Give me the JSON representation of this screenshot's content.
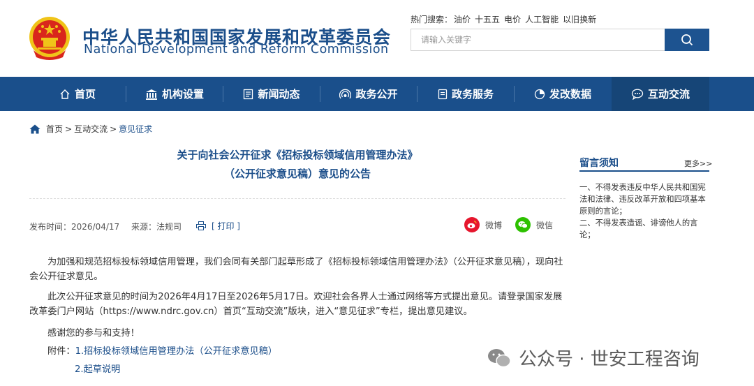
{
  "header": {
    "title_cn": "中华人民共和国国家发展和改革委员会",
    "title_en": "National Development and Reform Commission",
    "emblem_icon": "national-emblem-icon",
    "hot_label": "热门搜索：",
    "hot_words": [
      "油价",
      "十五五",
      "电价",
      "人工智能",
      "以旧换新"
    ],
    "search_placeholder": "请输入关键字",
    "search_icon": "search-icon"
  },
  "nav": {
    "items": [
      {
        "label": "首页",
        "icon": "home-icon"
      },
      {
        "label": "机构设置",
        "icon": "building-icon"
      },
      {
        "label": "新闻动态",
        "icon": "news-icon"
      },
      {
        "label": "政务公开",
        "icon": "broadcast-icon"
      },
      {
        "label": "政务服务",
        "icon": "document-icon"
      },
      {
        "label": "发改数据",
        "icon": "pie-chart-icon"
      },
      {
        "label": "互动交流",
        "icon": "chat-icon"
      }
    ],
    "active_index": 6
  },
  "breadcrumb": {
    "items": [
      "首页",
      "互动交流",
      "意见征求"
    ],
    "separator": ">"
  },
  "article": {
    "title_line1": "关于向社会公开征求《招标投标领域信用管理办法》",
    "title_line2": "（公开征求意见稿）意见的公告",
    "publish_time": "发布时间：2026/04/17",
    "source": "来源：法规司",
    "print": "[ 打印 ]",
    "share_weibo": "微博",
    "share_wechat": "微信",
    "paragraphs": [
      "为加强和规范招标投标领域信用管理，我们会同有关部门起草形成了《招标投标领域信用管理办法》（公开征求意见稿），现向社会公开征求意见。",
      "此次公开征求意见的时间为2026年4月17日至2026年5月17日。欢迎社会各界人士通过网络等方式提出意见。请登录国家发展改革委门户网站（https://www.ndrc.gov.cn）首页“互动交流”版块，进入“意见征求”专栏，提出意见建议。",
      "感谢您的参与和支持！"
    ],
    "attachment_label": "附件：",
    "attachments": [
      "1.招标投标领域信用管理办法（公开征求意见稿）",
      "2.起草说明"
    ]
  },
  "sidebar": {
    "title": "留言须知",
    "more": "更多>>",
    "text": "一、不得发表违反中华人民共和国宪法和法律、违反改革开放和四项基本原则的言论；\n二、不得发表造谣、诽谤他人的言论；"
  },
  "watermark": {
    "text": "公众号 · 世安工程咨询",
    "icon": "wechat-logo-icon"
  },
  "colors": {
    "brand_blue": "#1a4f8b",
    "nav_active": "#164577",
    "weibo_red": "#e6162d",
    "wechat_green": "#2dc100"
  }
}
